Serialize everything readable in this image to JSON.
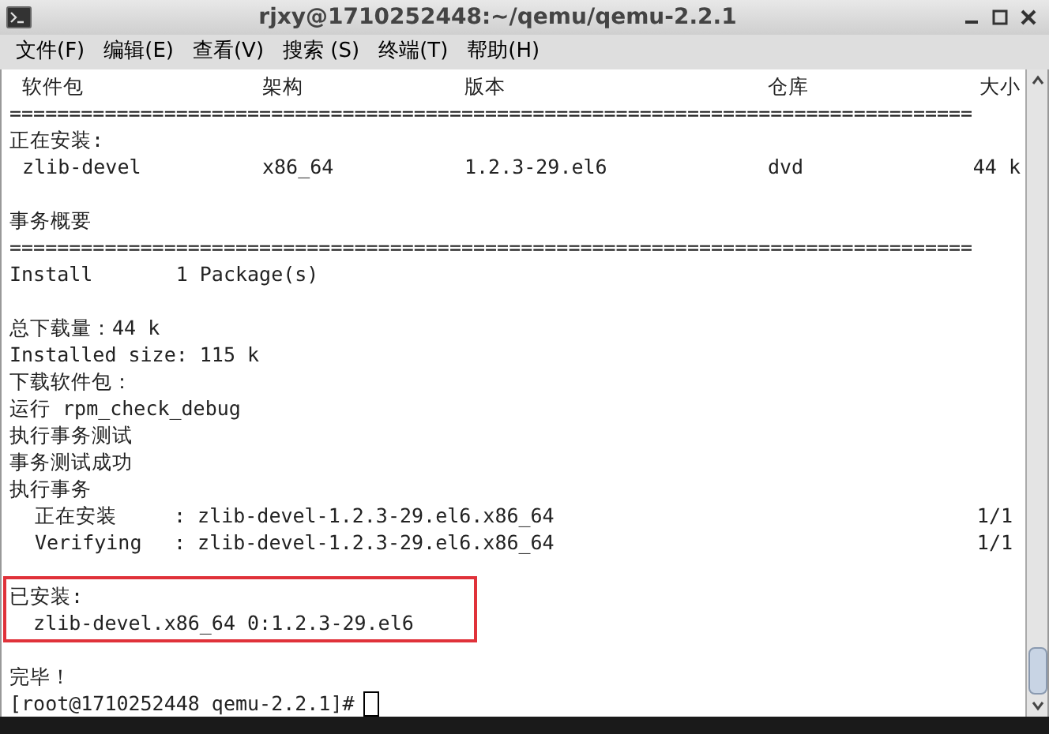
{
  "window": {
    "title": "rjxy@1710252448:~/qemu/qemu-2.2.1"
  },
  "menu": [
    "文件(F)",
    "编辑(E)",
    "查看(V)",
    "搜索 (S)",
    "终端(T)",
    "帮助(H)"
  ],
  "terminal": {
    "blocks": [
      {
        "kind": "table_row",
        "cells": [
          "软件包",
          "架构",
          "版本",
          "仓库",
          "大小"
        ]
      },
      {
        "kind": "rule",
        "text": "================================================================================="
      },
      {
        "kind": "line",
        "text": "正在安装:"
      },
      {
        "kind": "table_row",
        "cells": [
          "zlib-devel",
          "x86_64",
          "1.2.3-29.el6",
          "dvd",
          "44 k"
        ]
      },
      {
        "kind": "blank"
      },
      {
        "kind": "line",
        "text": "事务概要"
      },
      {
        "kind": "rule",
        "text": "================================================================================="
      },
      {
        "kind": "line",
        "text": "Install       1 Package(s)"
      },
      {
        "kind": "blank"
      },
      {
        "kind": "line",
        "text": "总下载量：44 k"
      },
      {
        "kind": "line",
        "text": "Installed size: 115 k"
      },
      {
        "kind": "line",
        "text": "下载软件包："
      },
      {
        "kind": "line",
        "text": "运行 rpm_check_debug"
      },
      {
        "kind": "line",
        "text": "执行事务测试"
      },
      {
        "kind": "line",
        "text": "事务测试成功"
      },
      {
        "kind": "line",
        "text": "执行事务"
      },
      {
        "kind": "task_row",
        "label": "正在安装",
        "detail": ": zlib-devel-1.2.3-29.el6.x86_64",
        "counter": "1/1"
      },
      {
        "kind": "task_row",
        "label": "Verifying",
        "detail": ": zlib-devel-1.2.3-29.el6.x86_64",
        "counter": "1/1"
      },
      {
        "kind": "blank"
      },
      {
        "kind": "highlight",
        "lines": [
          "已安装:",
          "  zlib-devel.x86_64 0:1.2.3-29.el6"
        ]
      },
      {
        "kind": "blank"
      },
      {
        "kind": "line",
        "text": "完毕！"
      },
      {
        "kind": "prompt",
        "text": "[root@1710252448 qemu-2.2.1]#"
      }
    ]
  }
}
